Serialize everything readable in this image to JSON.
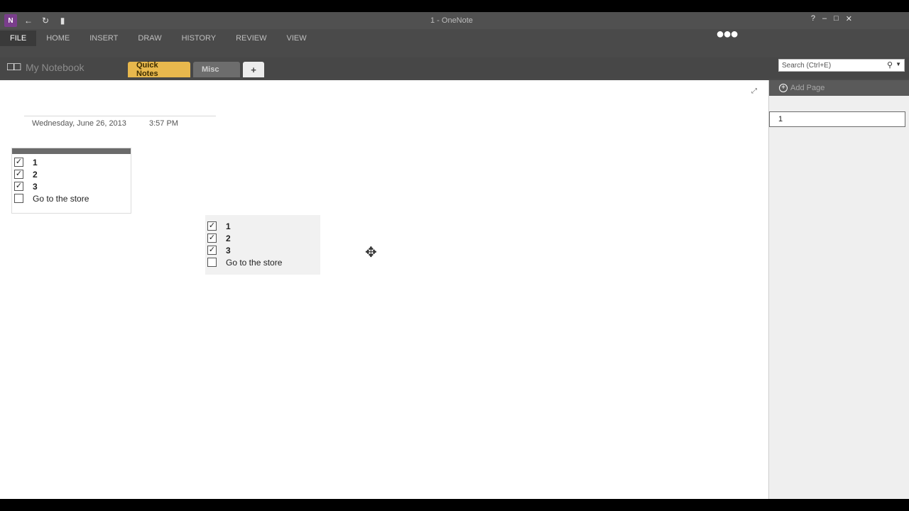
{
  "app": {
    "icon_letter": "N",
    "window_title": "1 - OneNote"
  },
  "qat": [
    {
      "name": "back-icon",
      "glyph": "←"
    },
    {
      "name": "sync-icon",
      "glyph": "↻"
    },
    {
      "name": "dock-icon",
      "glyph": "▮"
    }
  ],
  "window_controls": [
    "?",
    "–",
    "□",
    "✕"
  ],
  "ribbon": {
    "tabs": [
      "FILE",
      "HOME",
      "INSERT",
      "DRAW",
      "HISTORY",
      "REVIEW",
      "VIEW"
    ]
  },
  "notebook": {
    "name": "My Notebook",
    "sections": {
      "quick_notes": "Quick Notes",
      "other": "Misc",
      "add": "+"
    }
  },
  "search": {
    "placeholder": "Search (Ctrl+E)"
  },
  "page": {
    "date": "Wednesday, June 26, 2013",
    "time": "3:57 PM"
  },
  "lists": [
    {
      "items": [
        {
          "label": "1",
          "checked": true
        },
        {
          "label": "2",
          "checked": true
        },
        {
          "label": "3",
          "checked": true
        },
        {
          "label": "Go to the store",
          "checked": false
        }
      ]
    },
    {
      "items": [
        {
          "label": "1",
          "checked": true
        },
        {
          "label": "2",
          "checked": true
        },
        {
          "label": "3",
          "checked": true
        },
        {
          "label": "Go to the store",
          "checked": false
        }
      ]
    }
  ],
  "pages_pane": {
    "add_page_label": "Add Page",
    "pages": [
      {
        "title": "1"
      }
    ]
  }
}
